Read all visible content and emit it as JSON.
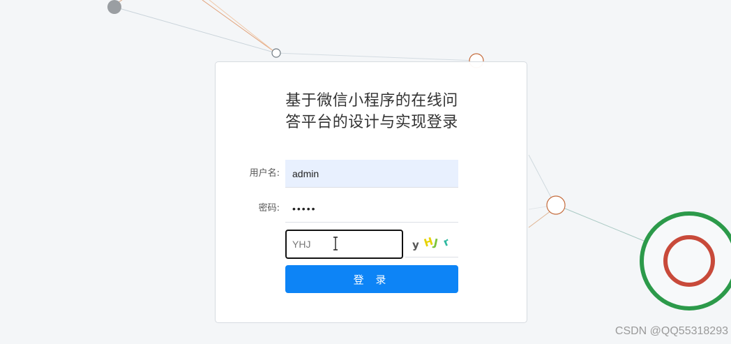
{
  "page": {
    "title": "基于微信小程序的在线问答平台的设计与实现登录"
  },
  "form": {
    "username_label": "用户名:",
    "username_value": "admin",
    "password_label": "密码:",
    "password_value": "admin",
    "captcha_value": "YHJ",
    "captcha_image_chars": [
      {
        "char": "y",
        "color": "#555555"
      },
      {
        "char": "H",
        "color": "#e6d200"
      },
      {
        "char": "J",
        "color": "#7cc43a"
      },
      {
        "char": "r",
        "color": "#2fb8a0"
      }
    ],
    "login_button_label": "登 录"
  },
  "colors": {
    "primary_button": "#0d84f6",
    "autofill_background": "#e8f0fe",
    "outer_ring": "#2c9a4a",
    "inner_ring": "#c84a3a"
  },
  "watermark": "CSDN @QQ55318293"
}
